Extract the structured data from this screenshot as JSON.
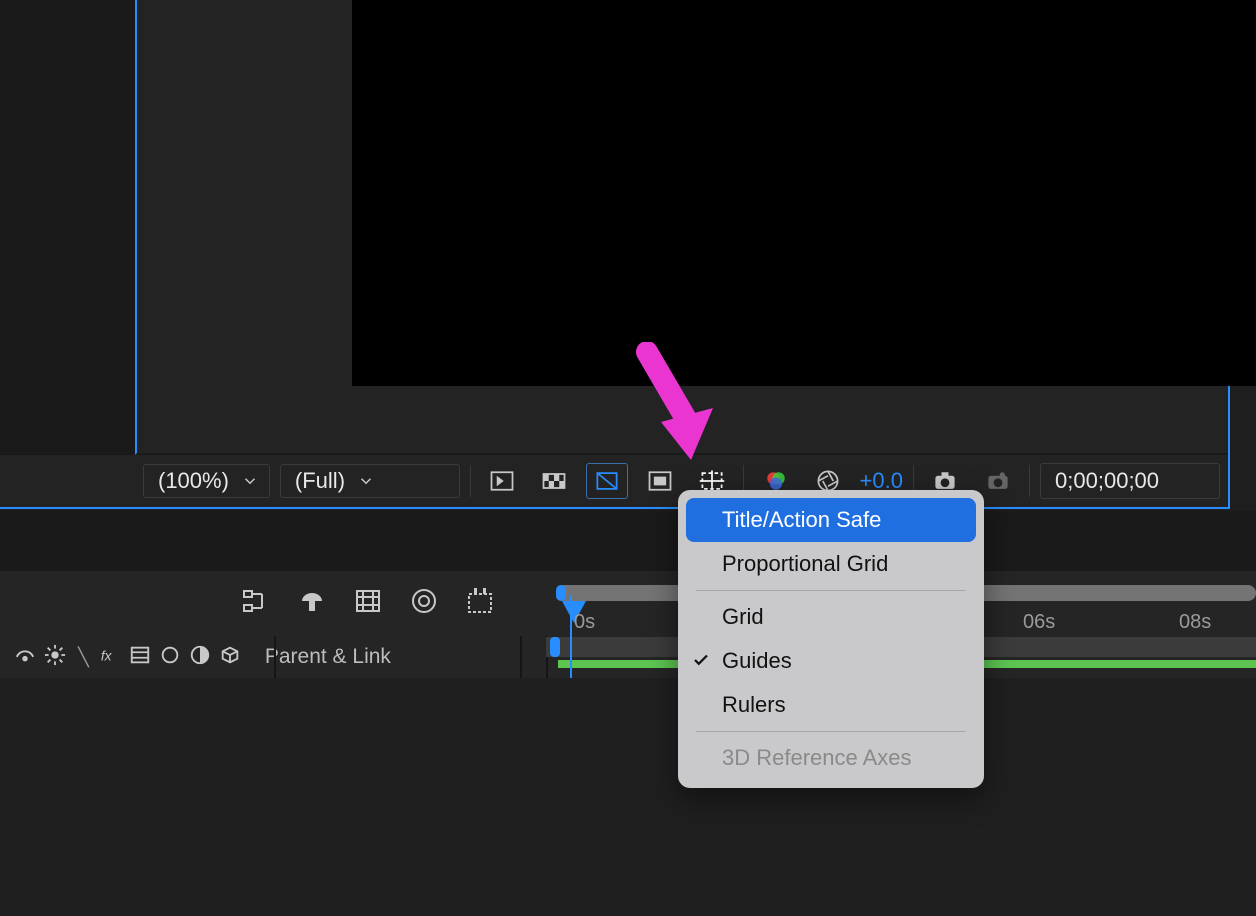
{
  "composition": {
    "zoom_label": "(100%)",
    "resolution_label": "(Full)",
    "exposure_value": "+0.0",
    "timecode": "0;00;00;00"
  },
  "footer_icons": {
    "fast_preview": "fast-preview-icon",
    "transparency": "transparency-grid-icon",
    "mask": "mask-roi-icon",
    "roi": "region-of-interest-icon",
    "grid_overlay": "grid-overlay-icon",
    "color_mgmt": "color-management-icon",
    "aperture": "aperture-icon",
    "snapshot": "snapshot-icon",
    "camera": "camera-icon"
  },
  "timeline": {
    "header_icons": [
      "graph-editor-icon",
      "mushroom-icon",
      "filmstrip-icon",
      "motion-blur-icon",
      "comp-settings-icon"
    ],
    "tick_labels": {
      "t1": "0s",
      "t2": "06s",
      "t3": "08s"
    },
    "column_icons": [
      "shy-icon",
      "sun-fx-icon",
      "fx-icon",
      "filmstrip-small-icon",
      "motion-blur-small-icon",
      "adjustment-icon",
      "3d-icon"
    ],
    "parent_link_label": "Parent & Link"
  },
  "menu": {
    "items": [
      {
        "label": "Title/Action Safe",
        "selected": true,
        "checked": false,
        "disabled": false
      },
      {
        "label": "Proportional Grid",
        "selected": false,
        "checked": false,
        "disabled": false
      },
      {
        "sep": true
      },
      {
        "label": "Grid",
        "selected": false,
        "checked": false,
        "disabled": false
      },
      {
        "label": "Guides",
        "selected": false,
        "checked": true,
        "disabled": false
      },
      {
        "label": "Rulers",
        "selected": false,
        "checked": false,
        "disabled": false
      },
      {
        "sep": true
      },
      {
        "label": "3D Reference Axes",
        "selected": false,
        "checked": false,
        "disabled": true
      }
    ]
  },
  "colors": {
    "accent": "#288dff",
    "panel": "#232323",
    "menu_sel": "#1f6fe0",
    "arrow": "#ea35d1"
  }
}
